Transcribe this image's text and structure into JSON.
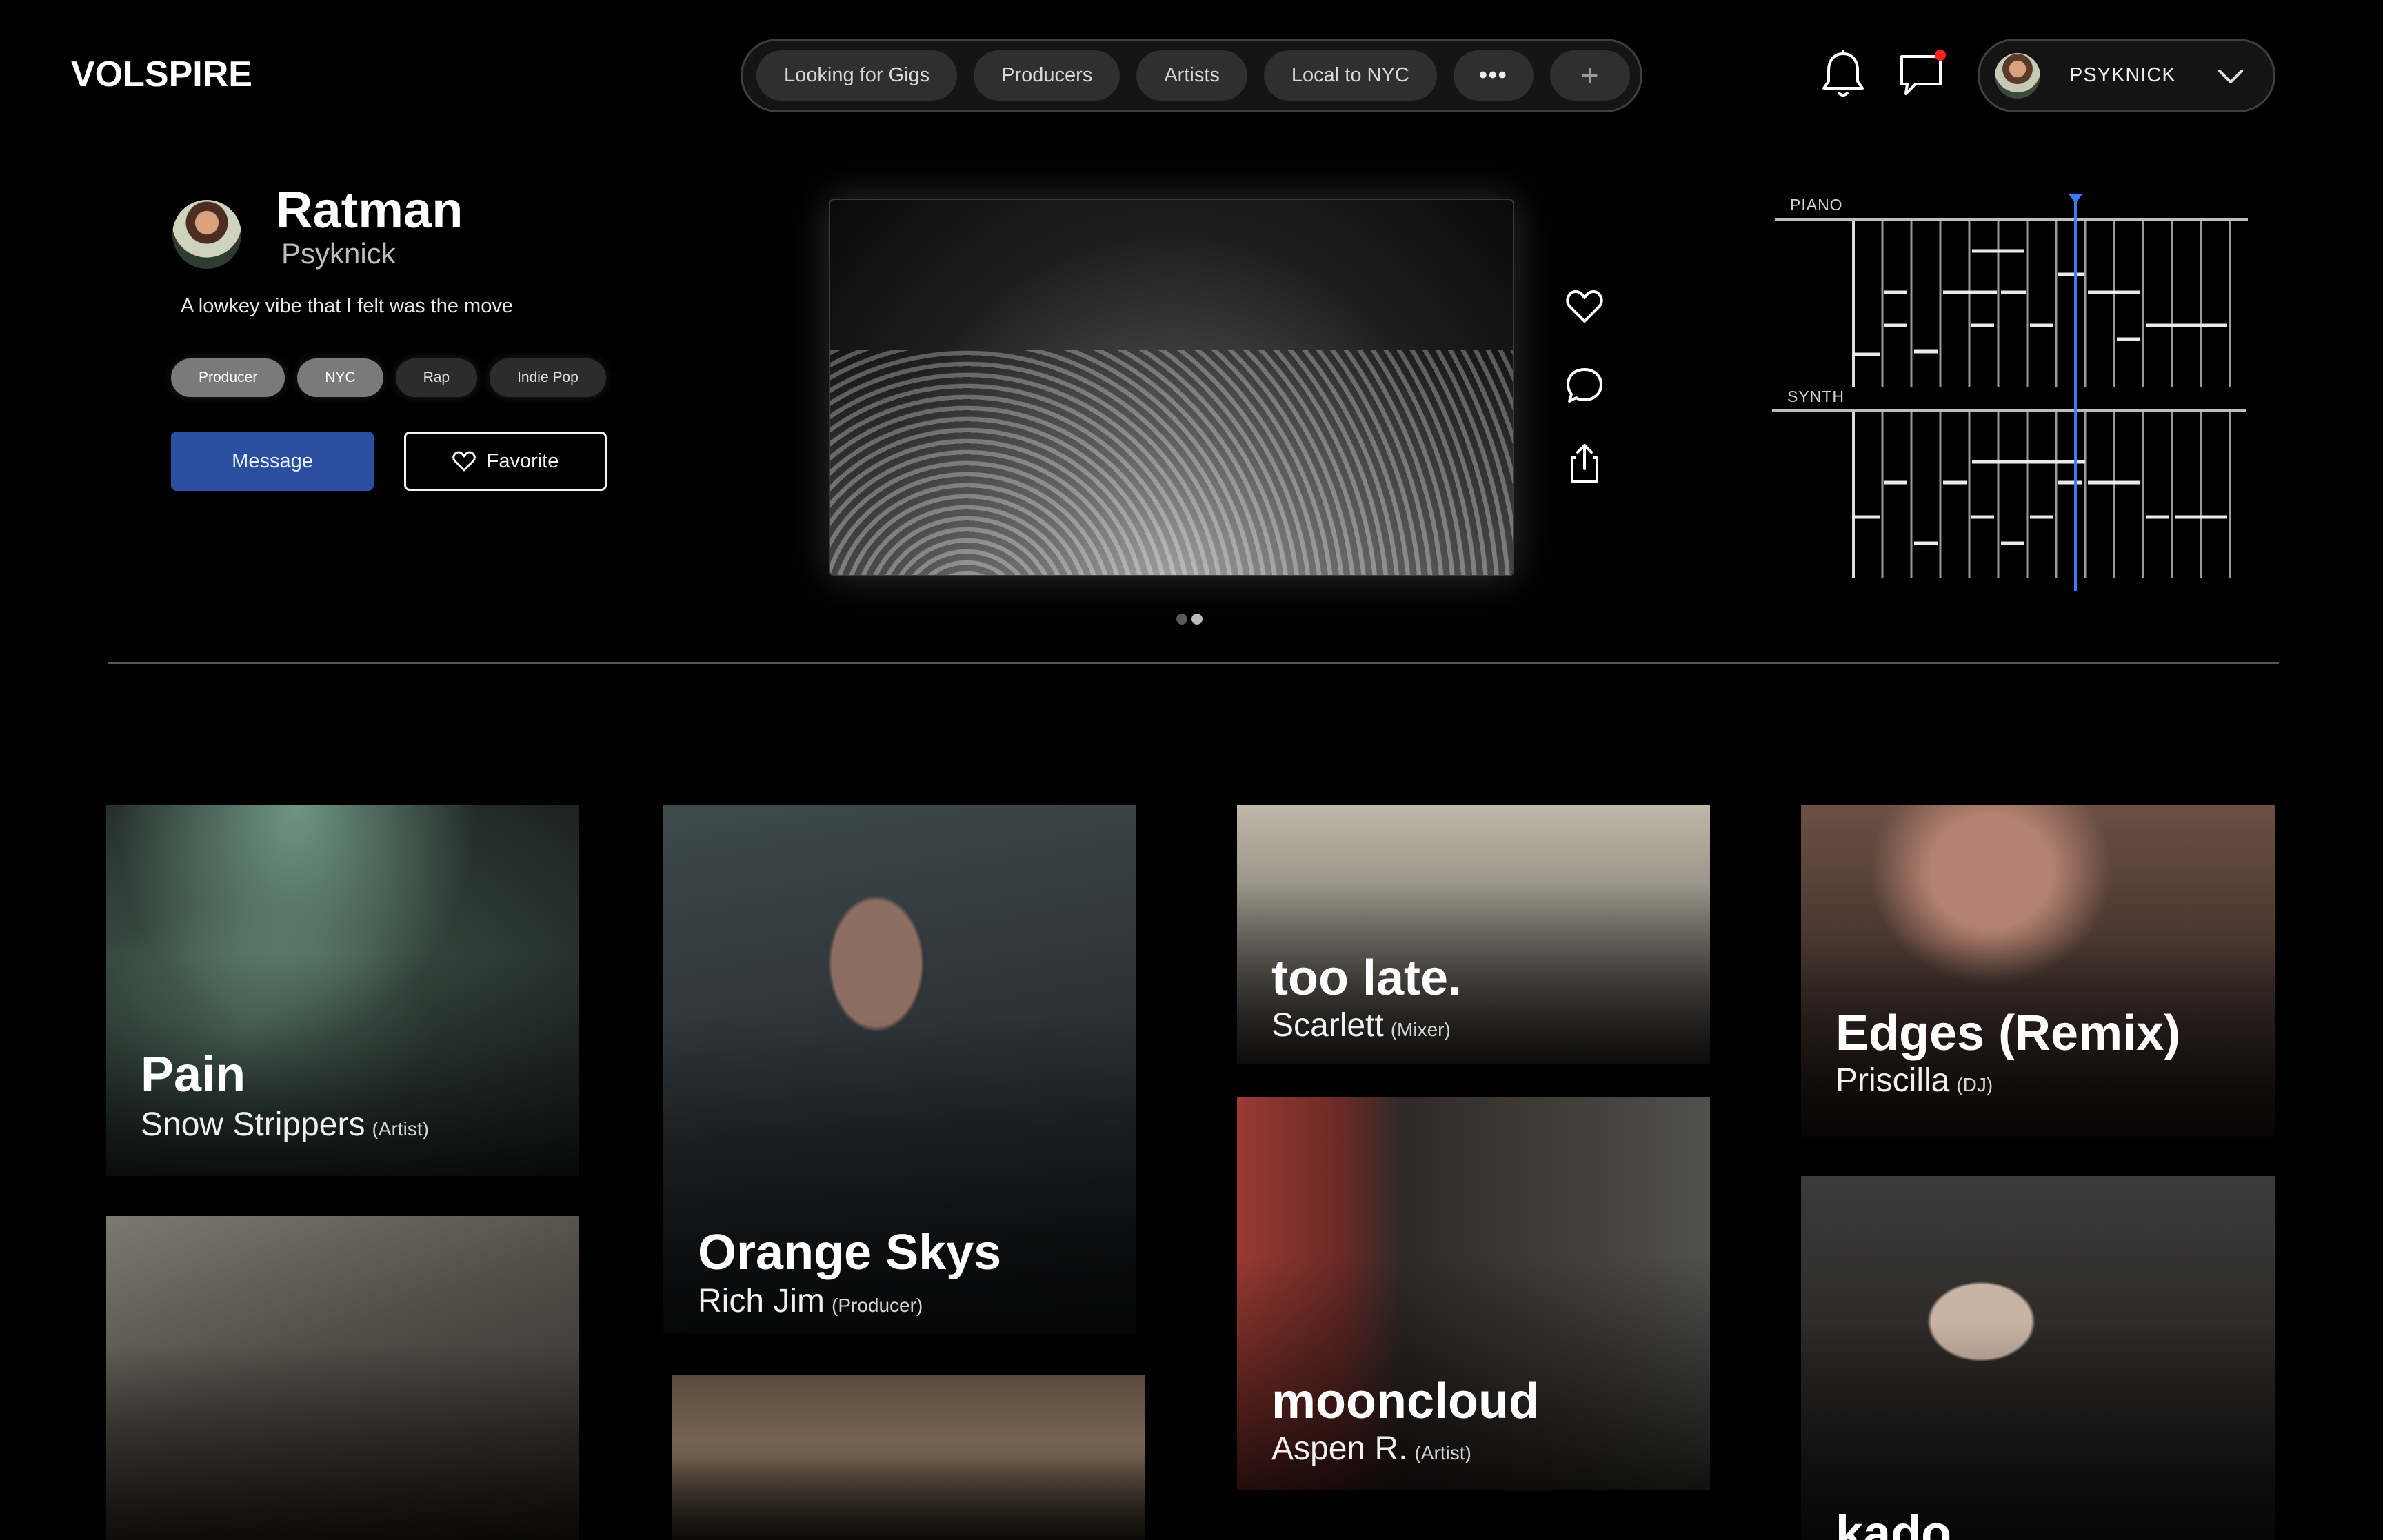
{
  "brand": {
    "logo": "VOLSPIRE"
  },
  "nav": {
    "chips": [
      "Looking for Gigs",
      "Producers",
      "Artists",
      "Local to NYC"
    ],
    "more_label": "•••",
    "add_label": "+"
  },
  "user": {
    "name": "PSYKNICK",
    "has_unread_messages": true
  },
  "profile": {
    "title": "Ratman",
    "artist": "Psyknick",
    "bio": "A lowkey vibe that I felt was the move",
    "tags": [
      "Producer",
      "NYC",
      "Rap",
      "Indie Pop"
    ],
    "message_label": "Message",
    "favorite_label": "Favorite"
  },
  "media": {
    "slide_count": 2,
    "active_slide": 2
  },
  "roll": {
    "tracks": [
      "PIANO",
      "SYNTH"
    ]
  },
  "colors": {
    "accent_blue": "#2a4fa0",
    "playhead": "#3a7bff",
    "notification": "#ff2020"
  },
  "feed": [
    {
      "title": "Pain",
      "artist": "Snow Strippers",
      "role": "(Artist)"
    },
    {
      "title": "",
      "artist": "",
      "role": ""
    },
    {
      "title": "Orange Skys",
      "artist": "Rich Jim",
      "role": "(Producer)"
    },
    {
      "title": "",
      "artist": "",
      "role": ""
    },
    {
      "title": "too late.",
      "artist": "Scarlett",
      "role": "(Mixer)"
    },
    {
      "title": "mooncloud",
      "artist": "Aspen R.",
      "role": "(Artist)"
    },
    {
      "title": "Edges (Remix)",
      "artist": "Priscilla",
      "role": "(DJ)"
    },
    {
      "title": "kado",
      "artist": "",
      "role": ""
    }
  ]
}
